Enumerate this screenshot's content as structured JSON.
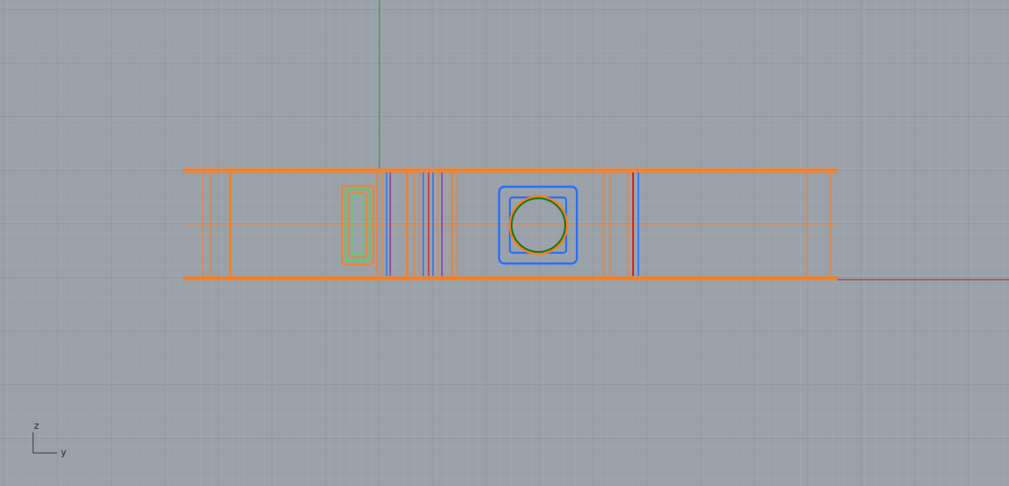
{
  "viewport": {
    "background_color": "#9aa1a8",
    "grid_minor_color": "#a6adb3",
    "grid_major_color": "#8b9299",
    "world_axis_x_color": "#a0403a",
    "world_axis_y_color": "#3fa34a"
  },
  "axis_indicator": {
    "vertical_label": "z",
    "horizontal_label": "y"
  },
  "colors": {
    "orange": "#ff7d1c",
    "blue": "#2870ff",
    "green": "#137a1c",
    "bright_green": "#3fe33f",
    "red": "#d81818",
    "purple": "#8a3aa8"
  }
}
